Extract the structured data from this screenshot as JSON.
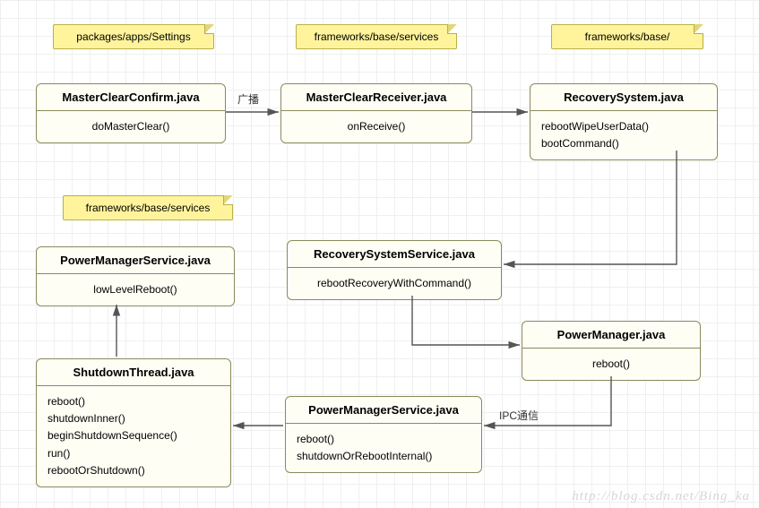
{
  "notes": {
    "n1": "packages/apps/Settings",
    "n2": "frameworks/base/services",
    "n3": "frameworks/base/",
    "n4": "frameworks/base/services"
  },
  "boxes": {
    "masterClearConfirm": {
      "title": "MasterClearConfirm.java",
      "body": "doMasterClear()"
    },
    "masterClearReceiver": {
      "title": "MasterClearReceiver.java",
      "body": "onReceive()"
    },
    "recoverySystem": {
      "title": "RecoverySystem.java",
      "body": "rebootWipeUserData()\nbootCommand()"
    },
    "powerManagerService1": {
      "title": "PowerManagerService.java",
      "body": "lowLevelReboot()"
    },
    "recoverySystemService": {
      "title": "RecoverySystemService.java",
      "body": "rebootRecoveryWithCommand()"
    },
    "powerManager": {
      "title": "PowerManager.java",
      "body": "reboot()"
    },
    "shutdownThread": {
      "title": "ShutdownThread.java",
      "body": "reboot()\nshutdownInner()\nbeginShutdownSequence()\nrun()\nrebootOrShutdown()"
    },
    "powerManagerService2": {
      "title": "PowerManagerService.java",
      "body": "reboot()\nshutdownOrRebootInternal()"
    }
  },
  "edgeLabels": {
    "broadcast": "广播",
    "ipc": "IPC通信"
  },
  "watermark": "http://blog.csdn.net/Bing_ka"
}
